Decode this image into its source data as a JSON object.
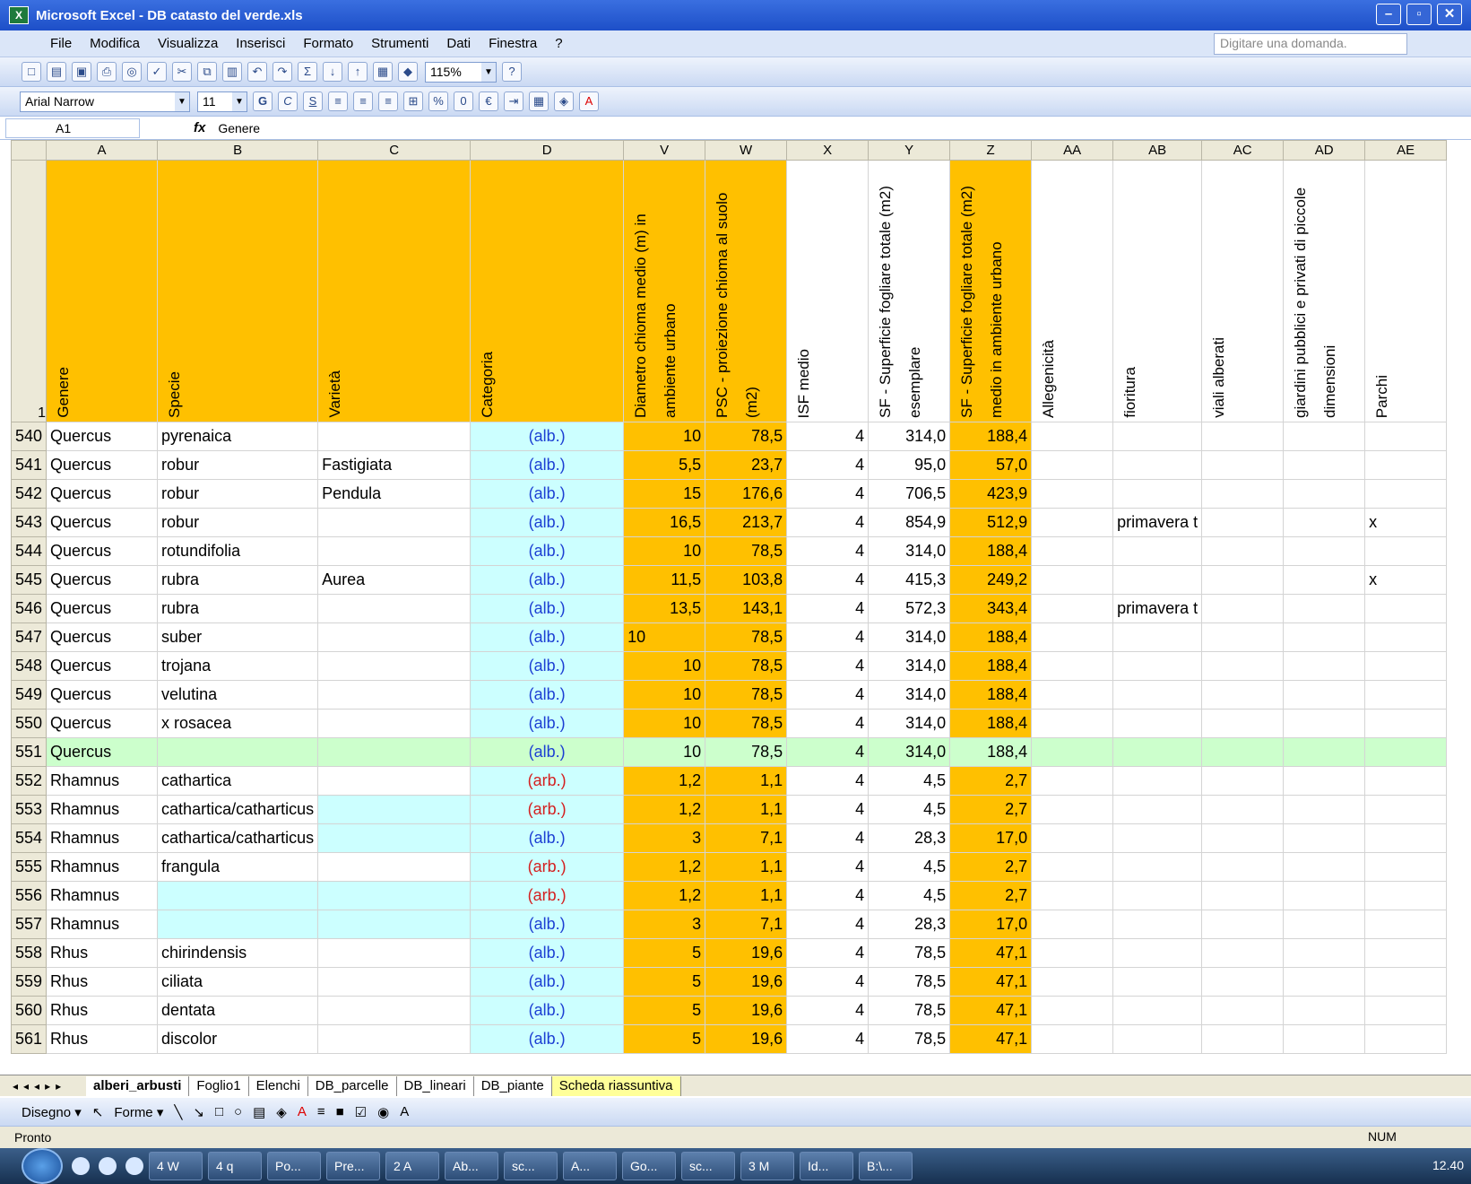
{
  "window": {
    "title": "Microsoft Excel - DB catasto del verde.xls",
    "controls": [
      "–",
      "▫",
      "✕"
    ]
  },
  "menu": {
    "items": [
      "File",
      "Modifica",
      "Visualizza",
      "Inserisci",
      "Formato",
      "Strumenti",
      "Dati",
      "Finestra",
      "?"
    ],
    "help_placeholder": "Digitare una domanda."
  },
  "toolbar": {
    "zoom": "115%",
    "font": "Arial Narrow",
    "size": "11",
    "bold": "G",
    "italic": "C",
    "underline": "S"
  },
  "formula_bar": {
    "name_box": "A1",
    "fx": "fx",
    "content": "Genere"
  },
  "columns": [
    "A",
    "B",
    "C",
    "D",
    "V",
    "W",
    "X",
    "Y",
    "Z",
    "AA",
    "AB",
    "AC",
    "AD",
    "AE"
  ],
  "header_row": {
    "row_number": "1",
    "cells": [
      "Genere",
      "Specie",
      "Varietà",
      "Categoria",
      "Diametro chioma medio (m) in ambiente urbano",
      "PSC - proiezione chioma al suolo (m2)",
      "ISF medio",
      "SF - Superficie fogliare totale (m2) esemplare",
      "SF - Superficie fogliare totale (m2) medio in ambiente urbano",
      "Allegenicità",
      "fioritura",
      "viali alberati",
      "giardini pubblici e privati di piccole dimensioni",
      "Parchi"
    ]
  },
  "rows": [
    {
      "n": "540",
      "A": "Quercus",
      "B": "pyrenaica",
      "C": "",
      "D": "(alb.)",
      "V": "10",
      "W": "78,5",
      "X": "4",
      "Y": "314,0",
      "Z": "188,4",
      "AB": "",
      "AE": ""
    },
    {
      "n": "541",
      "A": "Quercus",
      "B": "robur",
      "C": "Fastigiata",
      "D": "(alb.)",
      "V": "5,5",
      "W": "23,7",
      "X": "4",
      "Y": "95,0",
      "Z": "57,0",
      "AB": "",
      "AE": ""
    },
    {
      "n": "542",
      "A": "Quercus",
      "B": "robur",
      "C": "Pendula",
      "D": "(alb.)",
      "V": "15",
      "W": "176,6",
      "X": "4",
      "Y": "706,5",
      "Z": "423,9",
      "AB": "",
      "AE": ""
    },
    {
      "n": "543",
      "A": "Quercus",
      "B": "robur",
      "C": "",
      "D": "(alb.)",
      "V": "16,5",
      "W": "213,7",
      "X": "4",
      "Y": "854,9",
      "Z": "512,9",
      "AB": "primavera t",
      "AE": "x"
    },
    {
      "n": "544",
      "A": "Quercus",
      "B": "rotundifolia",
      "C": "",
      "D": "(alb.)",
      "V": "10",
      "W": "78,5",
      "X": "4",
      "Y": "314,0",
      "Z": "188,4",
      "AB": "",
      "AE": ""
    },
    {
      "n": "545",
      "A": "Quercus",
      "B": "rubra",
      "C": "Aurea",
      "D": "(alb.)",
      "V": "11,5",
      "W": "103,8",
      "X": "4",
      "Y": "415,3",
      "Z": "249,2",
      "AB": "",
      "AE": "x"
    },
    {
      "n": "546",
      "A": "Quercus",
      "B": "rubra",
      "C": "",
      "D": "(alb.)",
      "V": "13,5",
      "W": "143,1",
      "X": "4",
      "Y": "572,3",
      "Z": "343,4",
      "AB": "primavera t",
      "AE": ""
    },
    {
      "n": "547",
      "A": "Quercus",
      "B": "suber",
      "C": "",
      "D": "(alb.)",
      "V": "10",
      "W": "78,5",
      "X": "4",
      "Y": "314,0",
      "Z": "188,4",
      "AB": "",
      "AE": "",
      "vleft": true
    },
    {
      "n": "548",
      "A": "Quercus",
      "B": "trojana",
      "C": "",
      "D": "(alb.)",
      "V": "10",
      "W": "78,5",
      "X": "4",
      "Y": "314,0",
      "Z": "188,4",
      "AB": "",
      "AE": ""
    },
    {
      "n": "549",
      "A": "Quercus",
      "B": "velutina",
      "C": "",
      "D": "(alb.)",
      "V": "10",
      "W": "78,5",
      "X": "4",
      "Y": "314,0",
      "Z": "188,4",
      "AB": "",
      "AE": ""
    },
    {
      "n": "550",
      "A": "Quercus",
      "B": "x rosacea",
      "C": "",
      "D": "(alb.)",
      "V": "10",
      "W": "78,5",
      "X": "4",
      "Y": "314,0",
      "Z": "188,4",
      "AB": "",
      "AE": ""
    },
    {
      "n": "551",
      "A": "Quercus",
      "B": "",
      "C": "",
      "D": "(alb.)",
      "V": "10",
      "W": "78,5",
      "X": "4",
      "Y": "314,0",
      "Z": "188,4",
      "AB": "",
      "AE": "",
      "green": true
    },
    {
      "n": "552",
      "A": "Rhamnus",
      "B": "cathartica",
      "C": "",
      "D": "(arb.)",
      "V": "1,2",
      "W": "1,1",
      "X": "4",
      "Y": "4,5",
      "Z": "2,7",
      "AB": "",
      "AE": ""
    },
    {
      "n": "553",
      "A": "Rhamnus",
      "B": "cathartica/catharticus",
      "C": "",
      "D": "(arb.)",
      "V": "1,2",
      "W": "1,1",
      "X": "4",
      "Y": "4,5",
      "Z": "2,7",
      "AB": "",
      "AE": "",
      "ccyan": true
    },
    {
      "n": "554",
      "A": "Rhamnus",
      "B": "cathartica/catharticus",
      "C": "",
      "D": "(alb.)",
      "V": "3",
      "W": "7,1",
      "X": "4",
      "Y": "28,3",
      "Z": "17,0",
      "AB": "",
      "AE": "",
      "ccyan": true
    },
    {
      "n": "555",
      "A": "Rhamnus",
      "B": "frangula",
      "C": "",
      "D": "(arb.)",
      "V": "1,2",
      "W": "1,1",
      "X": "4",
      "Y": "4,5",
      "Z": "2,7",
      "AB": "",
      "AE": ""
    },
    {
      "n": "556",
      "A": "Rhamnus",
      "B": "",
      "C": "",
      "D": "(arb.)",
      "V": "1,2",
      "W": "1,1",
      "X": "4",
      "Y": "4,5",
      "Z": "2,7",
      "AB": "",
      "AE": "",
      "bccyan": true
    },
    {
      "n": "557",
      "A": "Rhamnus",
      "B": "",
      "C": "",
      "D": "(alb.)",
      "V": "3",
      "W": "7,1",
      "X": "4",
      "Y": "28,3",
      "Z": "17,0",
      "AB": "",
      "AE": "",
      "bccyan": true
    },
    {
      "n": "558",
      "A": "Rhus",
      "B": "chirindensis",
      "C": "",
      "D": "(alb.)",
      "V": "5",
      "W": "19,6",
      "X": "4",
      "Y": "78,5",
      "Z": "47,1",
      "AB": "",
      "AE": ""
    },
    {
      "n": "559",
      "A": "Rhus",
      "B": "ciliata",
      "C": "",
      "D": "(alb.)",
      "V": "5",
      "W": "19,6",
      "X": "4",
      "Y": "78,5",
      "Z": "47,1",
      "AB": "",
      "AE": ""
    },
    {
      "n": "560",
      "A": "Rhus",
      "B": "dentata",
      "C": "",
      "D": "(alb.)",
      "V": "5",
      "W": "19,6",
      "X": "4",
      "Y": "78,5",
      "Z": "47,1",
      "AB": "",
      "AE": ""
    },
    {
      "n": "561",
      "A": "Rhus",
      "B": "discolor",
      "C": "",
      "D": "(alb.)",
      "V": "5",
      "W": "19,6",
      "X": "4",
      "Y": "78,5",
      "Z": "47,1",
      "AB": "",
      "AE": ""
    }
  ],
  "sheet_tabs": [
    "alberi_arbusti",
    "Foglio1",
    "Elenchi",
    "DB_parcelle",
    "DB_lineari",
    "DB_piante",
    "Scheda riassuntiva"
  ],
  "drawing": {
    "draw_label": "Disegno ▾",
    "shapes_label": "Forme ▾"
  },
  "status": {
    "left": "Pronto",
    "num": "NUM"
  },
  "taskbar": {
    "buttons": [
      "4 W",
      "4 q",
      "Po...",
      "Pre...",
      "2 A",
      "Ab...",
      "sc...",
      "A...",
      "Go...",
      "sc...",
      "3 M",
      "Id...",
      "B:\\..."
    ],
    "clock": "12.40"
  },
  "colors": {
    "header_yellow": "#ffc000",
    "category_cyan": "#ccffff",
    "highlight_green": "#ccffcc",
    "alb_blue": "#1c3fd3",
    "arb_red": "#d42020"
  }
}
